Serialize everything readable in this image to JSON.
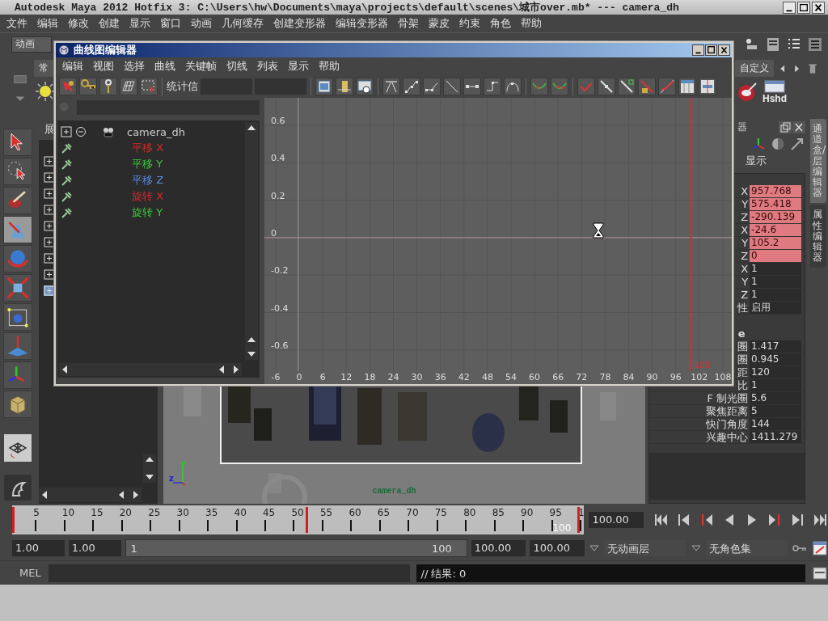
{
  "window": {
    "title": "Autodesk Maya 2012 Hotfix 3: C:\\Users\\hw\\Documents\\maya\\projects\\default\\scenes\\城市over.mb*  ---   camera_dh"
  },
  "menu": [
    "文件",
    "编辑",
    "修改",
    "创建",
    "显示",
    "窗口",
    "动画",
    "几何缓存",
    "创建变形器",
    "编辑变形器",
    "骨架",
    "蒙皮",
    "约束",
    "角色",
    "帮助"
  ],
  "status_line": {
    "mode": "动画"
  },
  "shelf": {
    "tab_left": "常",
    "tab_right": "自定义",
    "button_label": "Hshd"
  },
  "outliner": {
    "title": "展",
    "rows": [
      {
        "selected": false
      },
      {
        "selected": false
      },
      {
        "selected": false
      },
      {
        "selected": false
      },
      {
        "selected": false
      },
      {
        "selected": false
      },
      {
        "selected": false
      },
      {
        "selected": false
      },
      {
        "selected": true
      }
    ]
  },
  "viewport": {
    "camera_label": "camera_dh",
    "axis_labels": [
      "y",
      "z"
    ]
  },
  "channel_box": {
    "title": "器",
    "menu": "显示",
    "channels": [
      {
        "name": "X",
        "value": "957.768",
        "keyed": true
      },
      {
        "name": "Y",
        "value": "575.418",
        "keyed": true
      },
      {
        "name": "Z",
        "value": "-290.139",
        "keyed": true
      },
      {
        "name": "X",
        "value": "-24.6",
        "keyed": true
      },
      {
        "name": "Y",
        "value": "105.2",
        "keyed": true
      },
      {
        "name": "Z",
        "value": "0",
        "keyed": true
      },
      {
        "name": "X",
        "value": "1",
        "keyed": false
      },
      {
        "name": "Y",
        "value": "1",
        "keyed": false
      },
      {
        "name": "Z",
        "value": "1",
        "keyed": false
      },
      {
        "name": "性",
        "value": "启用",
        "keyed": false
      }
    ],
    "shape_title": "e",
    "shape_channels": [
      {
        "name": "圈",
        "value": "1.417"
      },
      {
        "name": "圈",
        "value": "0.945"
      },
      {
        "name": "距",
        "value": "120"
      },
      {
        "name": "比",
        "value": "1"
      },
      {
        "name": "F 制光圈",
        "value": "5.6"
      },
      {
        "name": "聚焦距离",
        "value": "5"
      },
      {
        "name": "快门角度",
        "value": "144"
      },
      {
        "name": "兴趣中心",
        "value": "1411.279"
      }
    ]
  },
  "side_tabs": [
    {
      "label": "通道盒/层编辑器",
      "selected": true
    },
    {
      "label": "属性编辑器",
      "selected": false
    }
  ],
  "time_slider": {
    "ticks": [
      "5",
      "10",
      "15",
      "20",
      "25",
      "30",
      "35",
      "40",
      "45",
      "50",
      "55",
      "60",
      "65",
      "70",
      "75",
      "80",
      "85",
      "90",
      "95",
      "1"
    ],
    "current_frame_label": "100",
    "keys": [
      {
        "level": 0
      },
      {
        "level": 0.52
      },
      {
        "level": 1
      }
    ],
    "current_time": "100.00"
  },
  "range": {
    "level": 1,
    "start": "1.00",
    "playback_start": "1.00",
    "range_start": "1",
    "range_end": "100",
    "playback_end": "100.00",
    "end": "100.00",
    "anim_layer": "无动画层",
    "character_set": "无角色集"
  },
  "command_line": {
    "language": "MEL",
    "result": "// 结果: 0"
  },
  "graph_editor": {
    "title": "曲线图编辑器",
    "menu": [
      "编辑",
      "视图",
      "选择",
      "曲线",
      "关键帧",
      "切线",
      "列表",
      "显示",
      "帮助"
    ],
    "stats_label": "统计信",
    "outliner": {
      "object": "camera_dh",
      "curves": [
        {
          "name": "平移 X",
          "color": "#d42a2a"
        },
        {
          "name": "平移 Y",
          "color": "#3cc83c"
        },
        {
          "name": "平移 Z",
          "color": "#5a8de0"
        },
        {
          "name": "旋转 X",
          "color": "#d42a2a"
        },
        {
          "name": "旋转 Y",
          "color": "#3cc83c"
        }
      ]
    },
    "graph": {
      "y_labels": [
        "0.6",
        "0.4",
        "0.2",
        "0",
        "-0.2",
        "-0.4",
        "-0.6"
      ],
      "x_labels": [
        "-6",
        "0",
        "6",
        "12",
        "18",
        "24",
        "30",
        "36",
        "42",
        "48",
        "54",
        "60",
        "66",
        "72",
        "78",
        "84",
        "90",
        "96",
        "102",
        "108"
      ],
      "current_frame": {
        "label": "100",
        "level": 0.913
      }
    }
  }
}
